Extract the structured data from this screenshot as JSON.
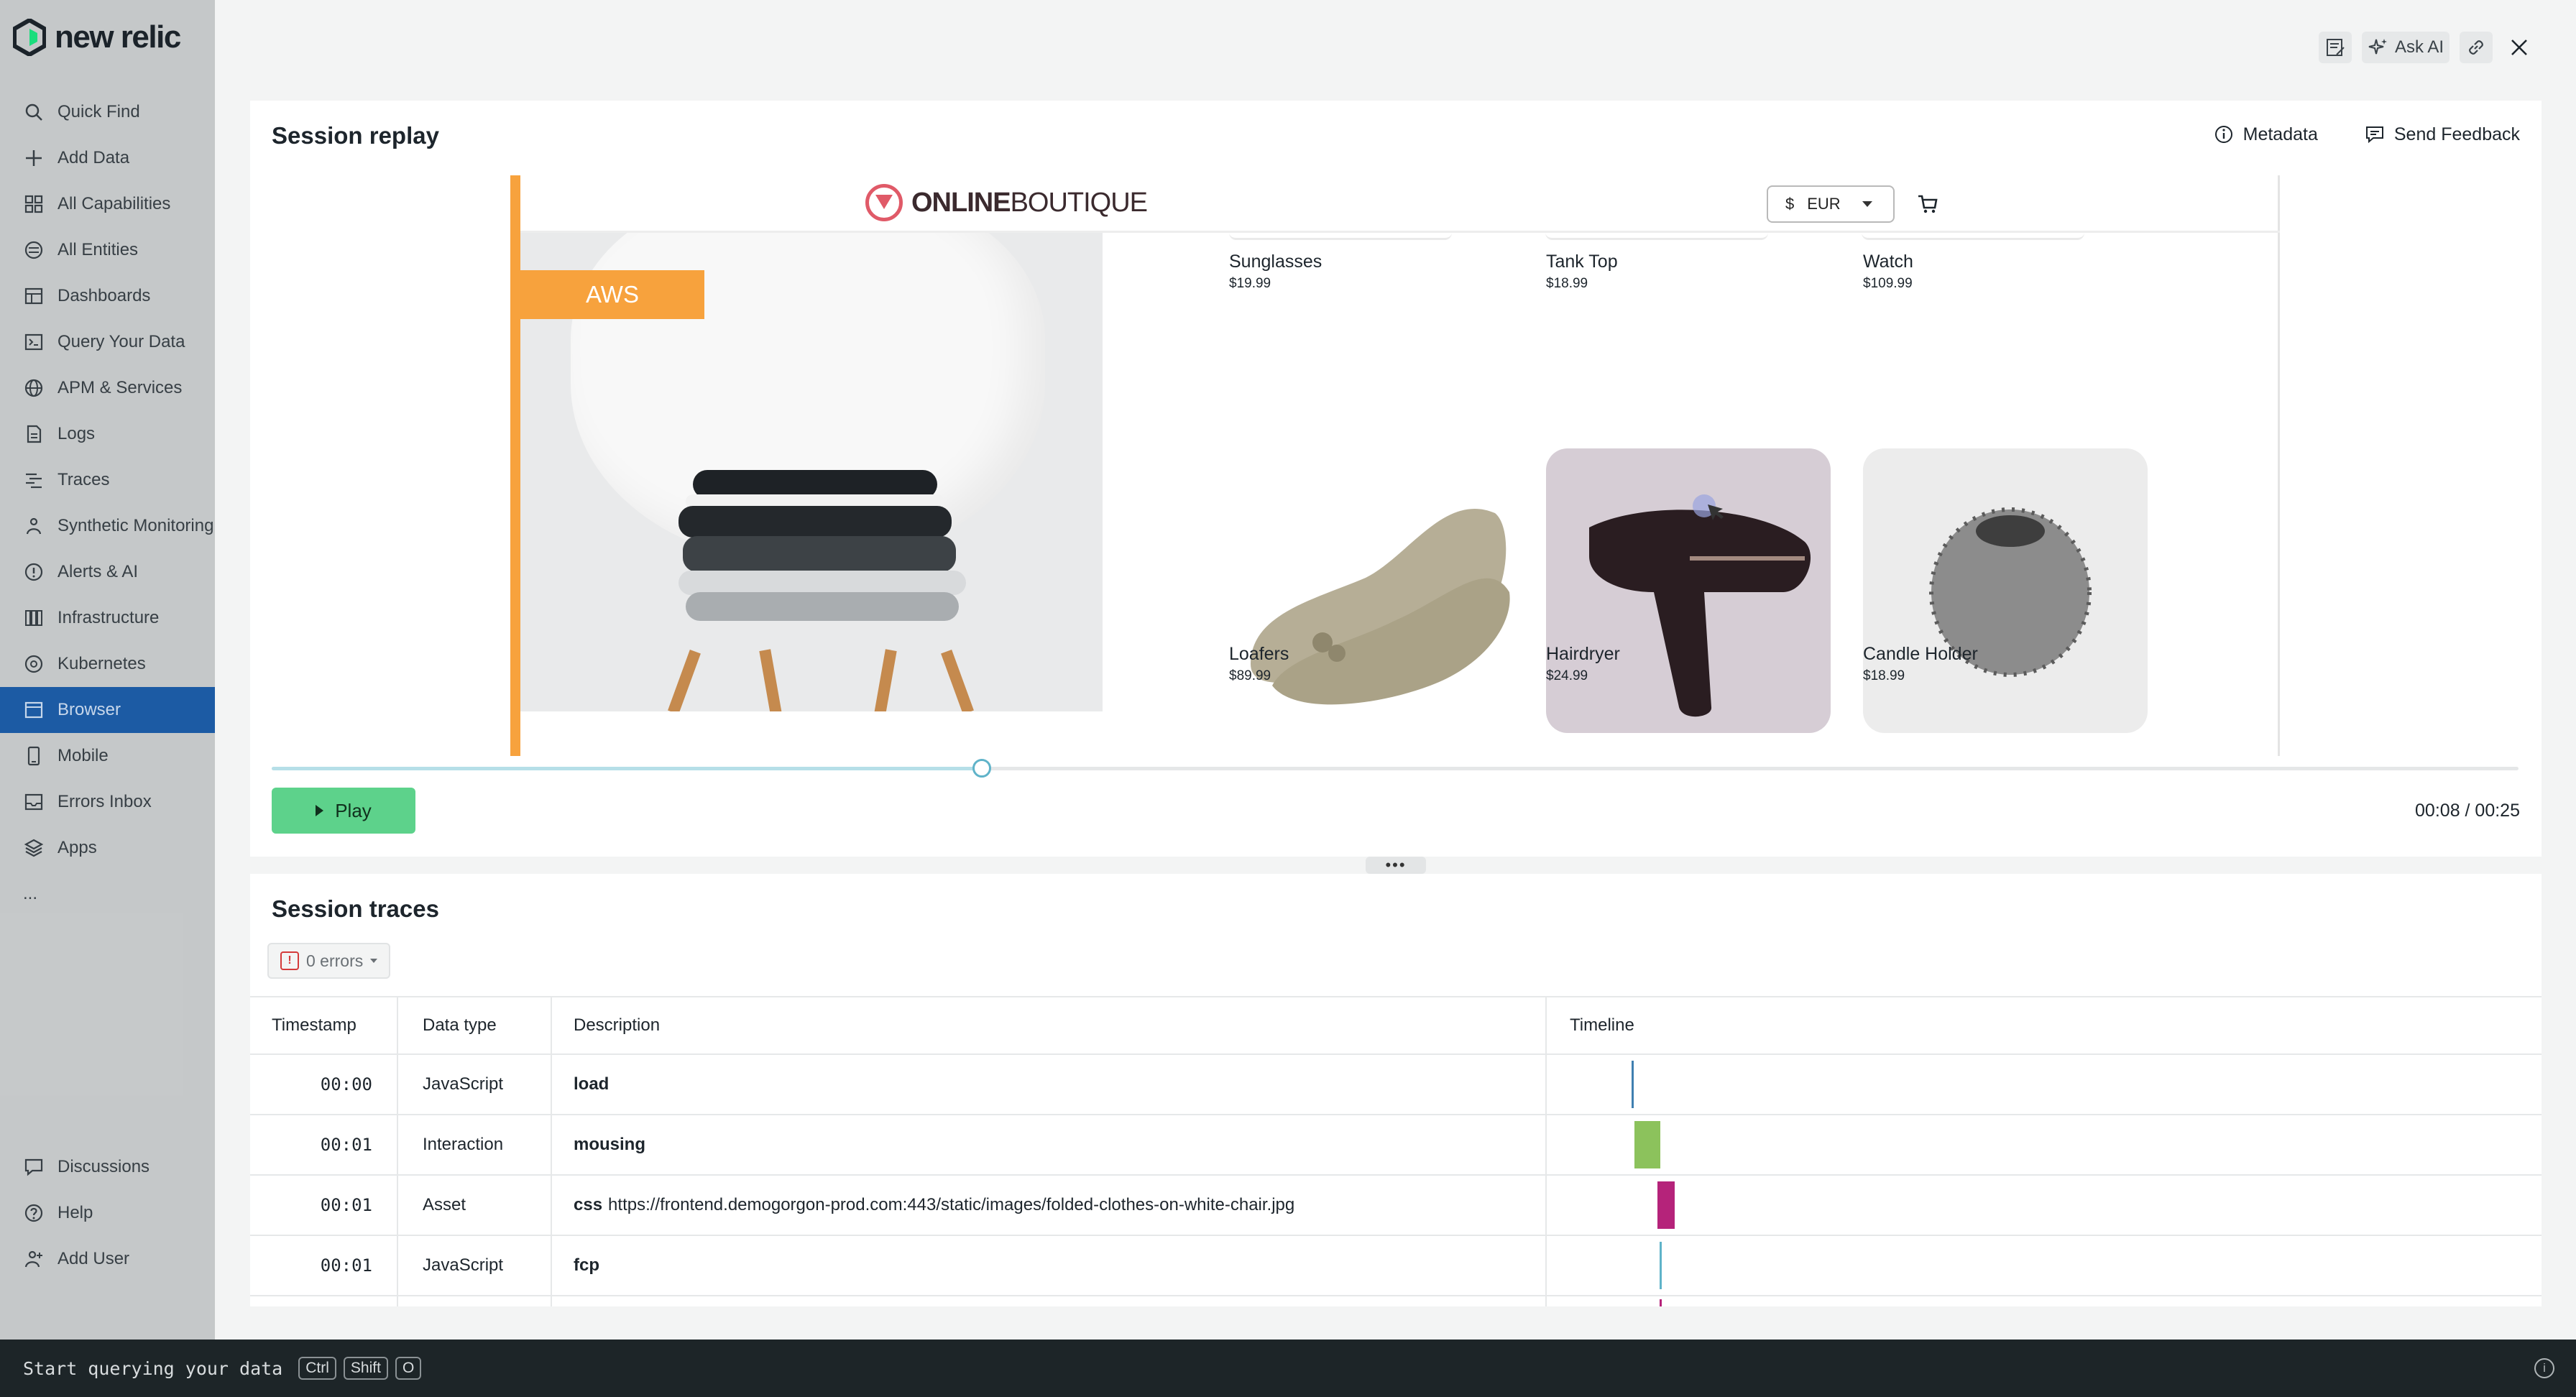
{
  "brand": {
    "name": "new relic"
  },
  "sidebar": {
    "items": [
      {
        "label": "Quick Find",
        "icon": "search-icon"
      },
      {
        "label": "Add Data",
        "icon": "plus-icon"
      },
      {
        "label": "All Capabilities",
        "icon": "grid-icon"
      },
      {
        "label": "All Entities",
        "icon": "entities-icon"
      },
      {
        "label": "Dashboards",
        "icon": "dashboard-icon"
      },
      {
        "label": "Query Your Data",
        "icon": "terminal-icon"
      },
      {
        "label": "APM & Services",
        "icon": "globe-icon"
      },
      {
        "label": "Logs",
        "icon": "document-icon"
      },
      {
        "label": "Traces",
        "icon": "traces-icon"
      },
      {
        "label": "Synthetic Monitoring",
        "icon": "person-icon"
      },
      {
        "label": "Alerts & AI",
        "icon": "alert-icon"
      },
      {
        "label": "Infrastructure",
        "icon": "infrastructure-icon"
      },
      {
        "label": "Kubernetes",
        "icon": "kubernetes-icon"
      },
      {
        "label": "Browser",
        "icon": "browser-icon",
        "active": true
      },
      {
        "label": "Mobile",
        "icon": "mobile-icon"
      },
      {
        "label": "Errors Inbox",
        "icon": "inbox-icon"
      },
      {
        "label": "Apps",
        "icon": "layers-icon"
      },
      {
        "label": "...",
        "icon": "more-icon"
      }
    ],
    "bottom_items": [
      {
        "label": "Discussions",
        "icon": "chat-icon"
      },
      {
        "label": "Help",
        "icon": "help-icon"
      },
      {
        "label": "Add User",
        "icon": "add-user-icon"
      }
    ]
  },
  "top_actions": {
    "ask_ai": "Ask AI"
  },
  "replay": {
    "title": "Session replay",
    "metadata_label": "Metadata",
    "feedback_label": "Send Feedback",
    "play_label": "Play",
    "time": "00:08 / 00:25",
    "progress": 0.316,
    "app": {
      "logo_bold": "ONLINE",
      "logo_rest": "BOUTIQUE",
      "currency_symbol": "$",
      "currency": "EUR",
      "banner": "AWS",
      "top_products": [
        {
          "name": "Sunglasses",
          "price": "$19.99"
        },
        {
          "name": "Tank Top",
          "price": "$18.99"
        },
        {
          "name": "Watch",
          "price": "$109.99"
        }
      ],
      "products": [
        {
          "name": "Loafers",
          "price": "$89.99"
        },
        {
          "name": "Hairdryer",
          "price": "$24.99"
        },
        {
          "name": "Candle Holder",
          "price": "$18.99"
        }
      ]
    }
  },
  "traces": {
    "title": "Session traces",
    "errors_label": "0 errors",
    "columns": [
      "Timestamp",
      "Data type",
      "Description",
      "Timeline"
    ],
    "rows": [
      {
        "timestamp": "00:00",
        "type": "JavaScript",
        "desc_bold": "load",
        "desc": "",
        "bar_color": "#3f7fb0"
      },
      {
        "timestamp": "00:01",
        "type": "Interaction",
        "desc_bold": "mousing",
        "desc": "",
        "bar_color": "#8cc25c"
      },
      {
        "timestamp": "00:01",
        "type": "Asset",
        "desc_bold": "css",
        "desc": "https://frontend.demogorgon-prod.com:443/static/images/folded-clothes-on-white-chair.jpg",
        "bar_color": "#b5237a"
      },
      {
        "timestamp": "00:01",
        "type": "JavaScript",
        "desc_bold": "fcp",
        "desc": "",
        "bar_color": "#5fb3c9"
      }
    ]
  },
  "bottom_bar": {
    "prompt": "Start querying your data",
    "keys": [
      "Ctrl",
      "Shift",
      "O"
    ]
  }
}
